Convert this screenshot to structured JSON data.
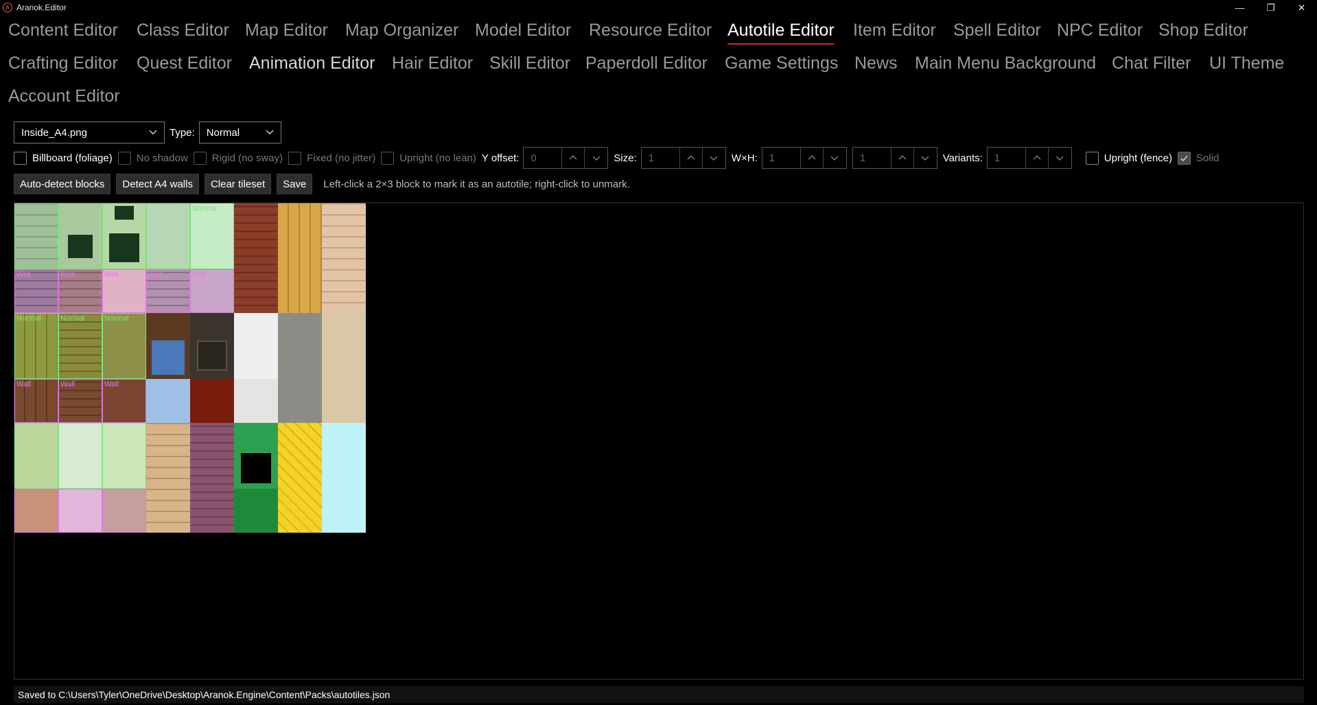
{
  "window": {
    "title": "Aranok.Editor",
    "logo_glyph": "A",
    "minimize": "—",
    "maximize": "❐",
    "close": "✕"
  },
  "tabs": {
    "row1": [
      "Content Editor",
      "Class Editor",
      "Map Editor",
      "Map Organizer",
      "Model Editor",
      "Resource Editor",
      "Autotile Editor",
      "Item Editor",
      "Spell Editor",
      "NPC Editor",
      "Shop Editor"
    ],
    "row2": [
      "Crafting Editor",
      "Quest Editor",
      "Animation Editor",
      "Hair Editor",
      "Skill Editor",
      "Paperdoll Editor",
      "Game Settings",
      "News",
      "Main Menu Background",
      "Chat Filter",
      "UI Theme"
    ],
    "row3": [
      "Account Editor"
    ],
    "active": "Autotile Editor"
  },
  "toolbar": {
    "tileset_value": "Inside_A4.png",
    "type_label": "Type:",
    "type_value": "Normal",
    "billboard_label": "Billboard (foliage)",
    "no_shadow_label": "No shadow",
    "rigid_label": "Rigid (no sway)",
    "fixed_label": "Fixed (no jitter)",
    "upright_label": "Upright (no lean)",
    "y_offset_label": "Y offset:",
    "y_offset_value": "0",
    "size_label": "Size:",
    "size_value": "1",
    "wxh_label": "W×H:",
    "w_value": "1",
    "h_value": "1",
    "variants_label": "Variants:",
    "variants_value": "1",
    "upright_fence_label": "Upright (fence)",
    "solid_label": "Solid",
    "solid_checked": true
  },
  "actions": {
    "auto_detect": "Auto-detect blocks",
    "detect_a4": "Detect A4 walls",
    "clear_tileset": "Clear tileset",
    "save": "Save",
    "hint": "Left-click a 2×3 block to mark it as an autotile; right-click to unmark."
  },
  "tile_labels": {
    "normal": "Normal",
    "wall": "Wall"
  },
  "status": {
    "text": "Saved to C:\\Users\\Tyler\\OneDrive\\Desktop\\Aranok.Engine\\Content\\Packs\\autotiles.json"
  },
  "colors": {
    "accent": "#d8232a",
    "normal_mark": "#7de37d",
    "wall_mark": "#d77ad7"
  }
}
